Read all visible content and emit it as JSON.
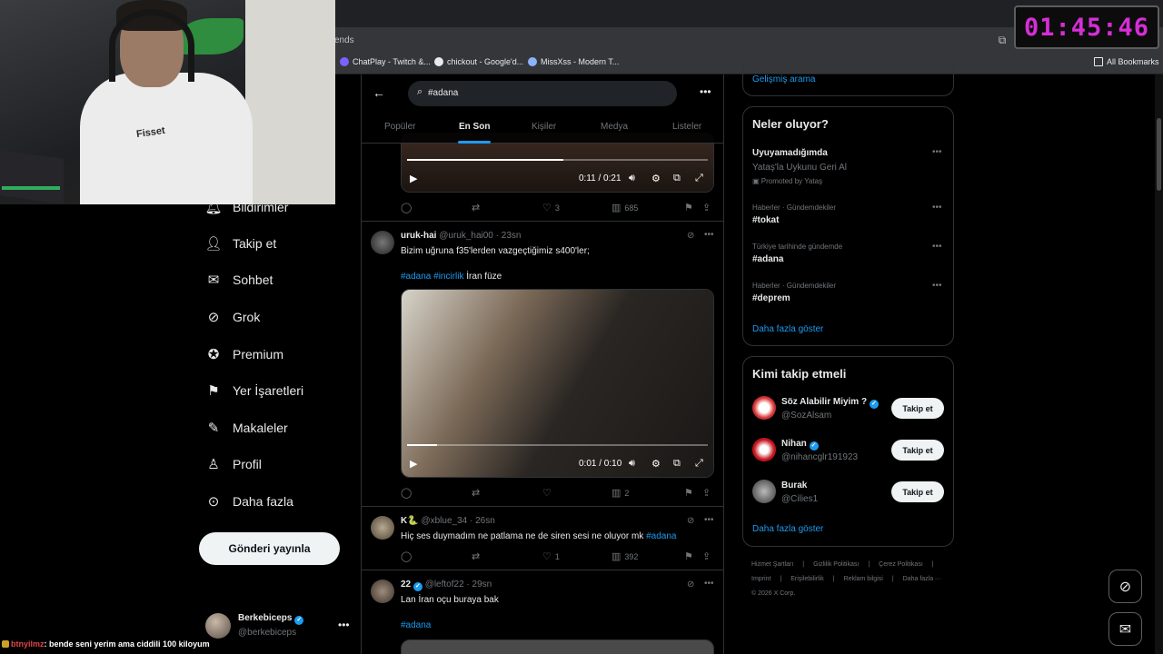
{
  "browser": {
    "address_fragment": "ends",
    "bookmarks": [
      "ChatPlay - Twitch &...",
      "chickout - Google'd...",
      "MissXss - Modern T...",
      "All Bookmarks"
    ]
  },
  "overlay": {
    "timer": "01:45:46",
    "chat_nick": "btnyilmz",
    "chat_message": ": bende seni yerim ama ciddili 100 kiloyum",
    "webcam_shirt_text": "Fisset"
  },
  "nav": {
    "items": [
      "Bildirimler",
      "Takip et",
      "Sohbet",
      "Grok",
      "Premium",
      "Yer İşaretleri",
      "Makaleler",
      "Profil",
      "Daha fazla"
    ],
    "post_button": "Gönderi yayınla",
    "profile": {
      "name": "Berkebiceps",
      "handle": "@berkebiceps"
    }
  },
  "search": {
    "value": "#adana",
    "tabs": [
      "Popüler",
      "En Son",
      "Kişiler",
      "Medya",
      "Listeler"
    ],
    "active_tab": "En Son"
  },
  "feed": {
    "first_video": {
      "time": "0:11 / 0:21",
      "progress": 0.52
    },
    "first_actions": {
      "replies": "",
      "retweets": "",
      "likes": "3",
      "views": "685"
    },
    "tweets": [
      {
        "name": "uruk-hai",
        "meta": "@uruk_hai00 · 23sn",
        "line1": "Bizim uğruna f35'lerden vazgeçtiğimiz s400'ler;",
        "tags": "#adana #incirlik",
        "tail": " İran füze",
        "video_time": "0:01 / 0:10",
        "video_progress": 0.1,
        "actions": {
          "likes": "",
          "views": "2"
        }
      },
      {
        "name": "K🐍",
        "meta": "@xblue_34 · 26sn",
        "text": "Hiç ses duymadım ne patlama ne de siren sesi ne oluyor mk ",
        "tag": "#adana",
        "actions": {
          "likes": "1",
          "views": "392"
        }
      },
      {
        "name": "22",
        "meta": "@leftof22 · 29sn",
        "text": "Lan İran oçu buraya bak",
        "tag": "#adana"
      }
    ]
  },
  "right": {
    "advanced_search": "Gelişmiş arama",
    "trends_title": "Neler oluyor?",
    "promoted": {
      "title": "Uyuyamadığımda",
      "subtitle": "Yataş'la Uykunu Geri Al",
      "label": "Promoted by Yataş"
    },
    "trends": [
      {
        "category": "Haberler · Gündemdekiler",
        "name": "#tokat"
      },
      {
        "category": "Türkiye tarihinde gündemde",
        "name": "#adana"
      },
      {
        "category": "Haberler · Gündemdekiler",
        "name": "#deprem"
      }
    ],
    "trends_more": "Daha fazla göster",
    "wtf_title": "Kimi takip etmeli",
    "follow_label": "Takip et",
    "who_to_follow": [
      {
        "name": "Söz Alabilir Miyim ?",
        "handle": "@SozAlsam"
      },
      {
        "name": "Nihan",
        "handle": "@nihancglr191923"
      },
      {
        "name": "Burak",
        "handle": "@Cilies1"
      }
    ],
    "wtf_more": "Daha fazla göster",
    "footer": [
      "Hizmet Şartları",
      "|",
      "Gizlilik Politikası",
      "|",
      "Çerez Politikası",
      "|",
      "Imprint",
      "|",
      "Erişilebilirlik",
      "|",
      "Reklam bilgisi",
      "|",
      "Daha fazla ···",
      "© 2026 X Corp."
    ]
  },
  "colors": {
    "accent": "#1d9bf0",
    "timer": "#d62ed6",
    "background": "#000000"
  }
}
